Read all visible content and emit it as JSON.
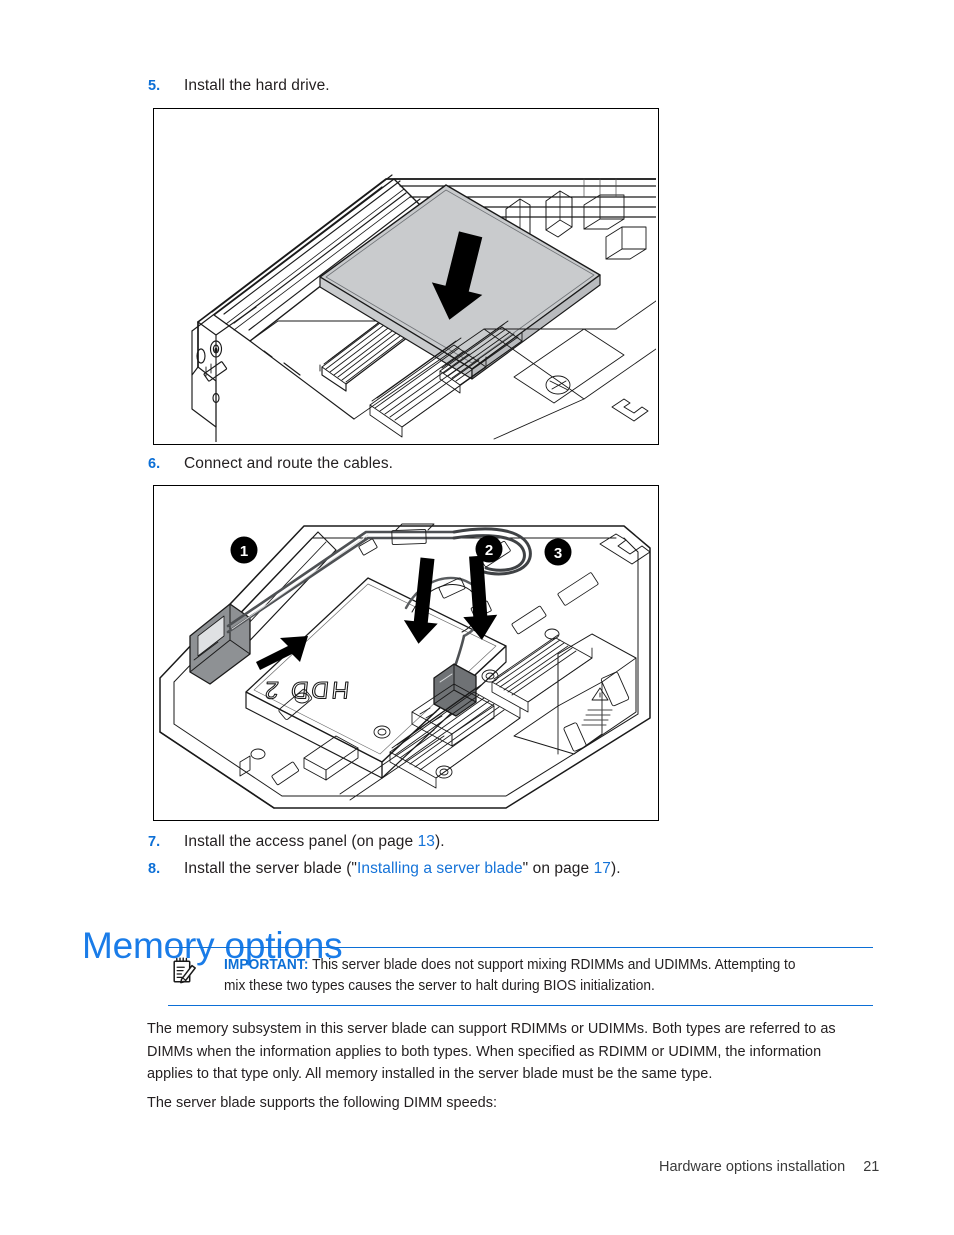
{
  "document": {
    "steps": [
      {
        "number": "5.",
        "text": "Install the hard drive."
      },
      {
        "number": "6.",
        "text": "Connect and route the cables."
      }
    ],
    "step7": {
      "number": "7.",
      "before": "Install the access panel (on page ",
      "page": "13",
      "after": ")."
    },
    "step8": {
      "number": "8.",
      "before": "Install the server blade (\"",
      "link": "Installing a server blade",
      "middle": "\" on page ",
      "page": "17",
      "after": ")."
    },
    "heading": "Memory options",
    "note": {
      "icon": "important-notepad-icon",
      "label": "IMPORTANT:",
      "line1": "This server blade does not support mixing RDIMMs and UDIMMs. Attempting to",
      "line2": "mix these two types causes the server to halt during BIOS initialization."
    },
    "paragraphs": {
      "p1_line1": "The memory subsystem in this server blade can support RDIMMs or UDIMMs. Both types are referred to as",
      "p1_line2": "DIMMs when the information applies to both types. When specified as RDIMM or UDIMM, the information",
      "p1_line3": "applies to that type only. All memory installed in the server blade must be the same type.",
      "p2": "The server blade supports the following DIMM speeds:"
    },
    "footer": {
      "chapter": "Hardware options installation",
      "page_number": "21"
    },
    "figures": {
      "figure1": {
        "caption_step": "5",
        "alt": "Isometric line drawing of a server blade with the hard drive being lowered into the drive bay, indicated by a large downward arrow on the drive.",
        "arrow": "down-arrow-install-drive"
      },
      "figure2": {
        "caption_step": "6",
        "alt": "Isometric line drawing of an opened server blade showing cable routing across the system board with three callouts.",
        "callouts": [
          {
            "label": "1",
            "meaning": "connect-hdd-cable-latch"
          },
          {
            "label": "2",
            "meaning": "route-cable-down"
          },
          {
            "label": "3",
            "meaning": "seat-connector-down"
          }
        ],
        "board_label": "HDD 2"
      }
    },
    "colors": {
      "accent_blue": "#0c6fd6",
      "heading_blue": "#1a7ce8",
      "link_blue": "#1573d8",
      "body_ink": "#231f20",
      "drive_fill": "#c9cbcd",
      "line_art": "#1a1a1a"
    }
  }
}
